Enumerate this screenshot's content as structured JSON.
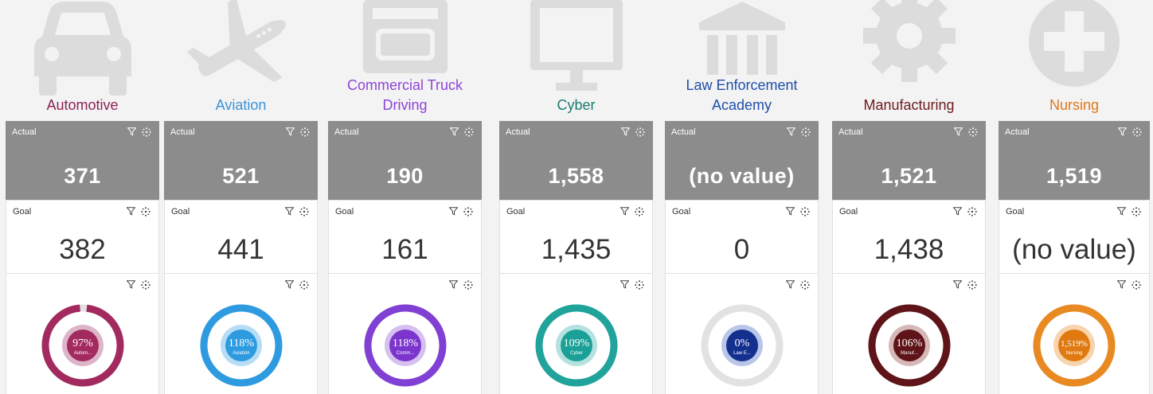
{
  "labels": {
    "actual": "Actual",
    "goal": "Goal"
  },
  "programs": [
    {
      "id": "automotive",
      "title_lines": [
        "Automotive"
      ],
      "title_color": "#8b2252",
      "icon": "car-icon",
      "actual": "371",
      "goal": "382",
      "ring": {
        "percent_text": "97%",
        "name": "Autom...",
        "progress": 0.97,
        "color": "#a32a5e",
        "center": "#a32a5e",
        "halo": "#ddb5c8"
      }
    },
    {
      "id": "aviation",
      "title_lines": [
        "Aviation"
      ],
      "title_color": "#3a93d6",
      "icon": "airplane-icon",
      "actual": "521",
      "goal": "441",
      "ring": {
        "percent_text": "118%",
        "name": "Aviation",
        "progress": 1,
        "color": "#2e9be0",
        "center": "#2e9be0",
        "halo": "#b7dcf5"
      }
    },
    {
      "id": "commercial-truck",
      "title_lines": [
        "Commercial Truck",
        "Driving"
      ],
      "title_color": "#8e44d9",
      "icon": "truck-icon",
      "actual": "190",
      "goal": "161",
      "ring": {
        "percent_text": "118%",
        "name": "Comm...",
        "progress": 1,
        "color": "#8140d4",
        "center": "#7b35cc",
        "halo": "#d6c0f0"
      }
    },
    {
      "id": "cyber",
      "title_lines": [
        "Cyber"
      ],
      "title_color": "#1c7a72",
      "icon": "monitor-icon",
      "actual": "1,558",
      "goal": "1,435",
      "ring": {
        "percent_text": "109%",
        "name": "Cyber",
        "progress": 1,
        "color": "#1fa39a",
        "center": "#1aa096",
        "halo": "#b5e2de"
      }
    },
    {
      "id": "law-enforcement",
      "title_lines": [
        "Law Enforcement",
        "Academy"
      ],
      "title_color": "#1f4fa8",
      "icon": "courthouse-icon",
      "actual": "(no value)",
      "goal": "0",
      "ring": {
        "percent_text": "0%",
        "name": "Law E...",
        "progress": 0,
        "color": "#1c3d9a",
        "center": "#14308f",
        "halo": "#b9c6e8"
      }
    },
    {
      "id": "manufacturing",
      "title_lines": [
        "Manufacturing"
      ],
      "title_color": "#6e1b1b",
      "icon": "gear-icon",
      "actual": "1,521",
      "goal": "1,438",
      "ring": {
        "percent_text": "106%",
        "name": "Manuf...",
        "progress": 1,
        "color": "#5e1418",
        "center": "#5e1418",
        "halo": "#d7b8b8"
      }
    },
    {
      "id": "nursing",
      "title_lines": [
        "Nursing"
      ],
      "title_color": "#e0781a",
      "icon": "medical-cross-icon",
      "actual": "1,519",
      "goal": "(no value)",
      "ring": {
        "percent_text": "1,519%",
        "name": "Nursing",
        "progress": 1,
        "color": "#e88a21",
        "center": "#e07a10",
        "halo": "#f7d4ae"
      }
    }
  ]
}
